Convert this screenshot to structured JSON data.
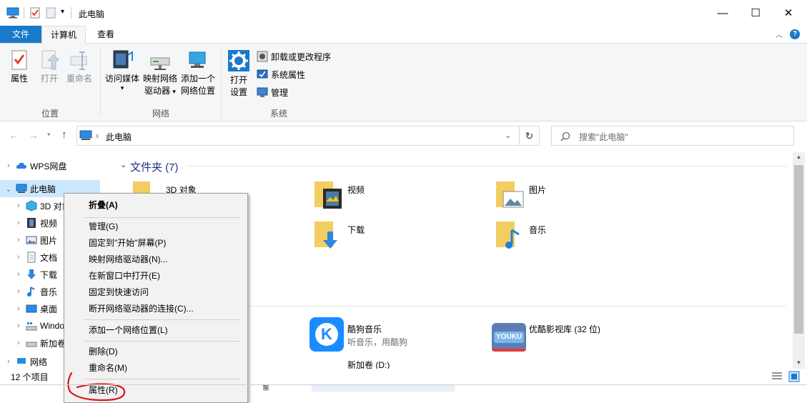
{
  "window": {
    "title": "此电脑",
    "minimize": "—",
    "maximize": "☐",
    "close": "✕"
  },
  "tabs": [
    {
      "label": "文件"
    },
    {
      "label": "计算机"
    },
    {
      "label": "查看"
    }
  ],
  "ribbon": {
    "location_group": {
      "label": "位置",
      "buttons": [
        "属性",
        "打开",
        "重命名"
      ]
    },
    "network_group": {
      "label": "网络",
      "access_media": "访问媒体",
      "map_drive_line1": "映射网络",
      "map_drive_line2": "驱动器",
      "add_location_line1": "添加一个",
      "add_location_line2": "网络位置"
    },
    "system_group": {
      "label": "系统",
      "open_settings_line1": "打开",
      "open_settings_line2": "设置",
      "uninstall": "卸载或更改程序",
      "system_properties": "系统属性",
      "manage": "管理"
    }
  },
  "address": {
    "path": "此电脑",
    "search_placeholder": "搜索\"此电脑\""
  },
  "nav_pane": {
    "items": [
      {
        "label": "WPS网盘"
      },
      {
        "label": "此电脑"
      },
      {
        "label": "3D 对象"
      },
      {
        "label": "视频"
      },
      {
        "label": "图片"
      },
      {
        "label": "文档"
      },
      {
        "label": "下载"
      },
      {
        "label": "音乐"
      },
      {
        "label": "桌面"
      },
      {
        "label": "Windo"
      },
      {
        "label": "新加卷"
      },
      {
        "label": "网络"
      }
    ]
  },
  "content": {
    "folders_header": "文件夹 (7)",
    "folders": [
      {
        "label": "3D 对象"
      },
      {
        "label": "视频"
      },
      {
        "label": "图片"
      },
      {
        "label": "下载"
      },
      {
        "label": "音乐"
      }
    ],
    "apps": [
      {
        "title": "酷狗音乐",
        "subtitle": "听音乐，用酷狗"
      },
      {
        "title": "优酷影视库 (32 位)",
        "subtitle": ""
      }
    ],
    "drive": {
      "label": "新加卷 (D:)"
    },
    "partial_text": "象"
  },
  "context_menu": {
    "items": [
      {
        "label": "折叠(A)",
        "bold": true
      },
      {
        "label": "管理(G)"
      },
      {
        "label": "固定到\"开始\"屏幕(P)"
      },
      {
        "label": "映射网络驱动器(N)..."
      },
      {
        "label": "在新窗口中打开(E)"
      },
      {
        "label": "固定到快速访问"
      },
      {
        "label": "断开网络驱动器的连接(C)..."
      },
      {
        "label": "添加一个网络位置(L)"
      },
      {
        "label": "删除(D)"
      },
      {
        "label": "重命名(M)"
      },
      {
        "label": "属性(R)"
      }
    ]
  },
  "status": {
    "item_count": "12 个项目"
  },
  "colors": {
    "accent": "#1979ca",
    "annotation": "#d7191c",
    "folder": "#f2cd60"
  }
}
